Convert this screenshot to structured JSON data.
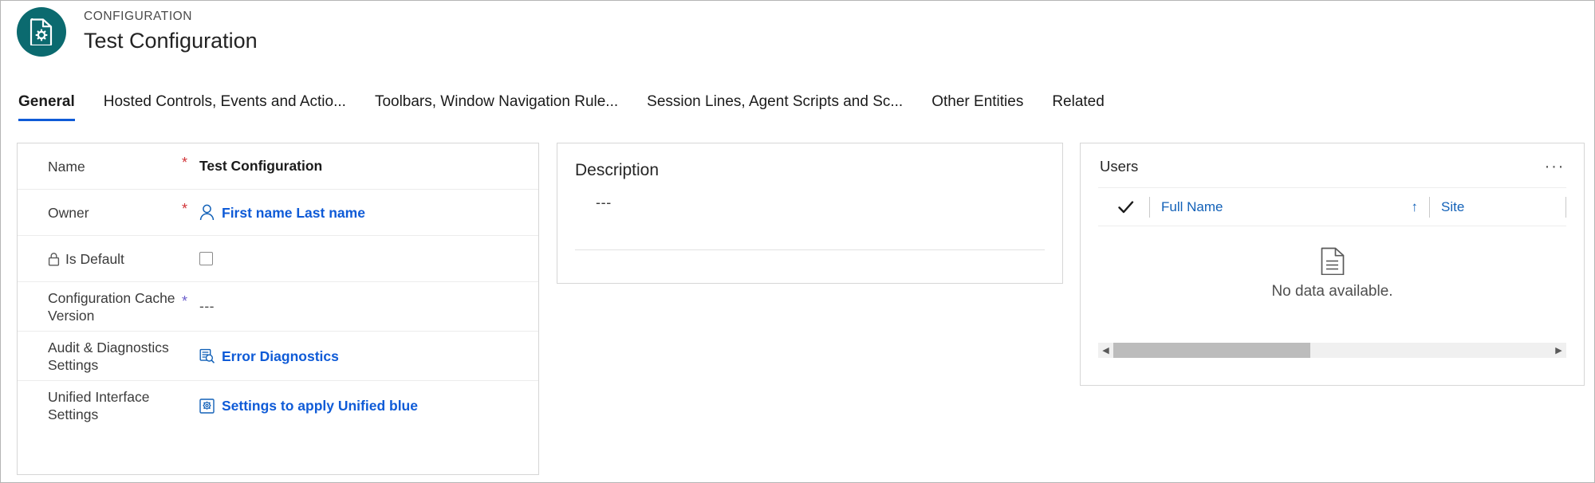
{
  "header": {
    "eyebrow": "CONFIGURATION",
    "title": "Test Configuration",
    "icon": "configuration-document-gear-icon",
    "icon_bg": "#0b6a6f"
  },
  "tabs": [
    {
      "label": "General",
      "selected": true
    },
    {
      "label": "Hosted Controls, Events and Actio...",
      "selected": false
    },
    {
      "label": "Toolbars, Window Navigation Rule...",
      "selected": false
    },
    {
      "label": "Session Lines, Agent Scripts and Sc...",
      "selected": false
    },
    {
      "label": "Other Entities",
      "selected": false
    },
    {
      "label": "Related",
      "selected": false
    }
  ],
  "form": {
    "fields": [
      {
        "label": "Name",
        "required": "*",
        "required_color": "#d13438",
        "value": "Test Configuration",
        "type": "text"
      },
      {
        "label": "Owner",
        "required": "*",
        "required_color": "#d13438",
        "value": "First name Last name",
        "type": "lookup",
        "icon": "person-icon"
      },
      {
        "label": "Is Default",
        "required": "",
        "value": "",
        "type": "checkbox",
        "icon": "lock-icon",
        "checked": false
      },
      {
        "label_line1": "Configuration Cache",
        "label_line2": "Version",
        "required": "*",
        "required_color": "#6b5ecb",
        "value": "---",
        "type": "text-muted"
      },
      {
        "label_line1": "Audit & Diagnostics",
        "label_line2": "Settings",
        "required": "",
        "value": "Error Diagnostics",
        "type": "link",
        "icon": "error-diagnostics-icon"
      },
      {
        "label_line1": "Unified Interface",
        "label_line2": "Settings",
        "required": "",
        "value": "Settings to apply Unified blue",
        "type": "link",
        "icon": "unified-settings-icon"
      }
    ]
  },
  "description": {
    "title": "Description",
    "value": "---"
  },
  "users": {
    "title": "Users",
    "more_label": "···",
    "columns": [
      {
        "label": "Full Name",
        "sort": "↑"
      },
      {
        "label": "Site",
        "sort": ""
      }
    ],
    "rows": [],
    "empty_message": "No data available.",
    "empty_icon": "document-lines-icon",
    "scrollbar": {
      "left_arrow": "◀",
      "right_arrow": "▶",
      "thumb_percent": 45
    }
  },
  "colors": {
    "accent_teal": "#0b6a6f",
    "link_blue": "#0f5bd7",
    "grid_link_blue": "#1261b8",
    "tab_underline": "#0f5bd7",
    "required_red": "#d13438",
    "required_purple": "#6b5ecb"
  }
}
